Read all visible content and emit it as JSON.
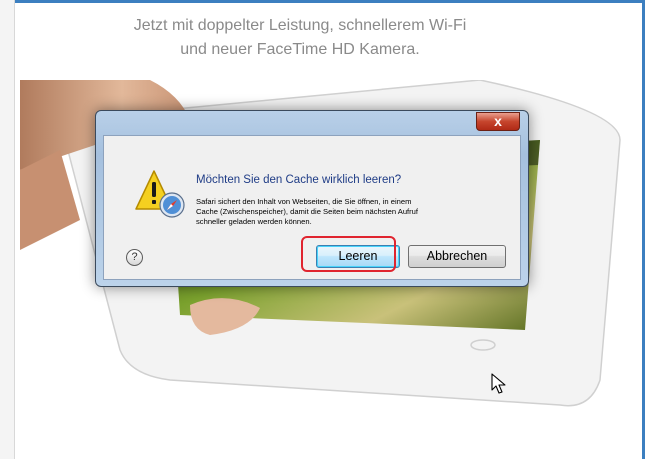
{
  "headline": {
    "line1": "Jetzt mit doppelter Leistung, schnellerem Wi-Fi",
    "line2": "und neuer FaceTime HD Kamera."
  },
  "dialog": {
    "close_label": "x",
    "main_instruction": "Möchten Sie den Cache wirklich leeren?",
    "content_lines": [
      "Safari sichert den Inhalt von Webseiten, die Sie öffnen, in einem",
      "Cache (Zwischenspeicher), damit die Seiten beim nächsten Aufruf",
      "schneller geladen werden können."
    ],
    "help_label": "?",
    "buttons": {
      "primary": "Leeren",
      "secondary": "Abbrechen"
    },
    "icons": {
      "warning": "warning-icon",
      "app": "safari-compass-icon"
    }
  },
  "colors": {
    "frame_border": "#3c7fc0",
    "headline_text": "#8a8a8a",
    "main_instruction_text": "#1f3c86",
    "highlight": "#e0242f"
  }
}
